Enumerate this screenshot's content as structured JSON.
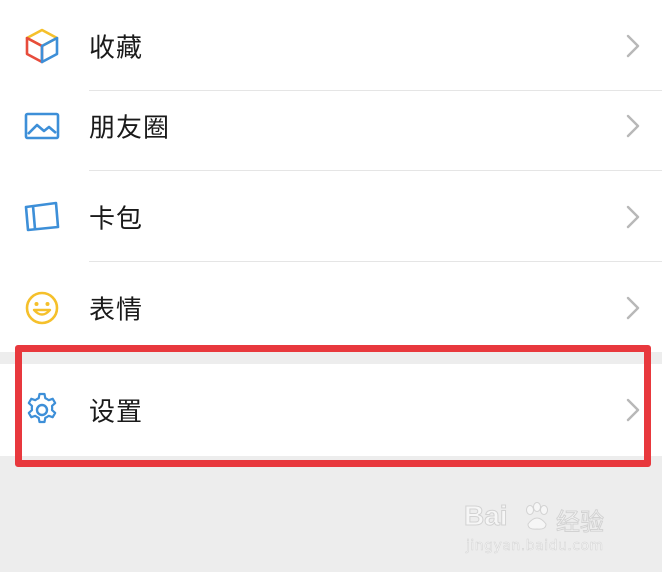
{
  "menu": {
    "items": [
      {
        "label": "收藏",
        "icon": "favorites-cube-icon"
      },
      {
        "label": "朋友圈",
        "icon": "moments-image-icon"
      },
      {
        "label": "卡包",
        "icon": "card-wallet-icon"
      },
      {
        "label": "表情",
        "icon": "sticker-smile-icon"
      }
    ],
    "settings": {
      "label": "设置",
      "icon": "gear-icon"
    }
  },
  "watermark": {
    "brand": "Bai",
    "brand_suffix": "经验",
    "url": "jingyan.baidu.com"
  },
  "colors": {
    "highlight": "#e8383d",
    "page_background": "#ededed",
    "row_background": "#ffffff",
    "divider": "#e5e5e5",
    "icon_blue": "#3d8fd8",
    "icon_yellow": "#f5c02b"
  }
}
